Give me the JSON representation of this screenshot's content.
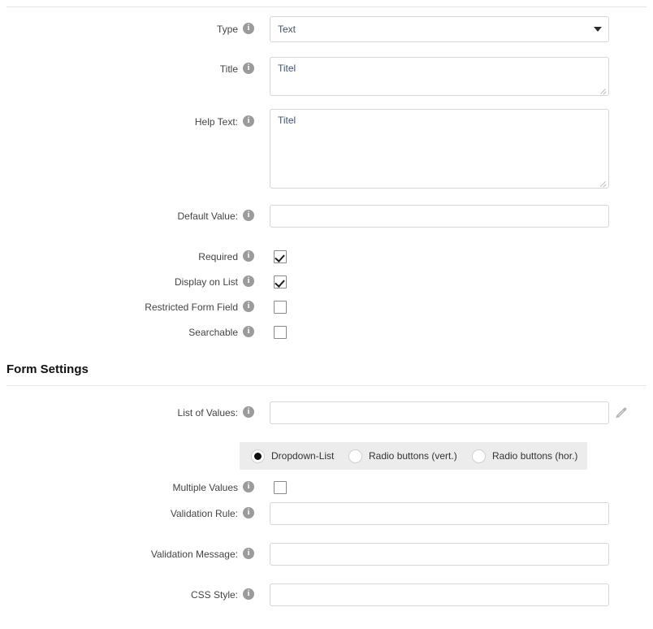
{
  "form": {
    "fields": [
      {
        "key": "type",
        "label": "Type",
        "icon": "info-icon",
        "icon_glyph": "i",
        "control": "select",
        "value": "Text"
      },
      {
        "key": "title",
        "label": "Title",
        "icon": "info-icon",
        "icon_glyph": "i",
        "control": "textarea",
        "value": "Titel"
      },
      {
        "key": "help_text",
        "label": "Help Text:",
        "icon": "info-icon",
        "icon_glyph": "i",
        "control": "textarea",
        "value": "Titel"
      },
      {
        "key": "default_value",
        "label": "Default Value:",
        "icon": "info-icon",
        "icon_glyph": "i",
        "control": "input",
        "value": ""
      },
      {
        "key": "required",
        "label": "Required",
        "icon": "info-icon",
        "icon_glyph": "i",
        "control": "checkbox",
        "checked": true
      },
      {
        "key": "display_on_list",
        "label": "Display on List",
        "icon": "info-icon",
        "icon_glyph": "i",
        "control": "checkbox",
        "checked": true
      },
      {
        "key": "restricted_form_field",
        "label": "Restricted Form Field",
        "icon": "info-icon",
        "icon_glyph": "i",
        "control": "checkbox",
        "checked": false
      },
      {
        "key": "searchable",
        "label": "Searchable",
        "icon": "info-icon",
        "icon_glyph": "i",
        "control": "checkbox",
        "checked": false
      }
    ]
  },
  "form_settings": {
    "heading": "Form Settings",
    "fields": [
      {
        "key": "list_of_values",
        "label": "List of Values:",
        "icon": "info-icon",
        "icon_glyph": "i",
        "control": "input",
        "value": "",
        "trailing_icon": "pencil-icon"
      },
      {
        "key": "multiple_values",
        "label": "Multiple Values",
        "icon": "info-icon",
        "icon_glyph": "i",
        "control": "checkbox",
        "checked": false
      },
      {
        "key": "validation_rule",
        "label": "Validation Rule:",
        "icon": "info-icon",
        "icon_glyph": "i",
        "control": "input",
        "value": ""
      },
      {
        "key": "validation_message",
        "label": "Validation Message:",
        "icon": "info-icon",
        "icon_glyph": "i",
        "control": "input",
        "value": ""
      },
      {
        "key": "css_style",
        "label": "CSS Style:",
        "icon": "info-icon",
        "icon_glyph": "i",
        "control": "input",
        "value": ""
      }
    ],
    "display_mode": {
      "selected": "Dropdown-List",
      "options": [
        {
          "label": "Dropdown-List",
          "selected": true
        },
        {
          "label": "Radio buttons (vert.)",
          "selected": false
        },
        {
          "label": "Radio buttons (hor.)",
          "selected": false
        }
      ]
    }
  },
  "colors": {
    "field_border": "#d6d6d6",
    "field_text": "#44546a",
    "label_text": "#444444",
    "info_icon_bg": "#9b9b9b",
    "panel_bg": "#ececec",
    "divider": "#e5e5e5"
  }
}
